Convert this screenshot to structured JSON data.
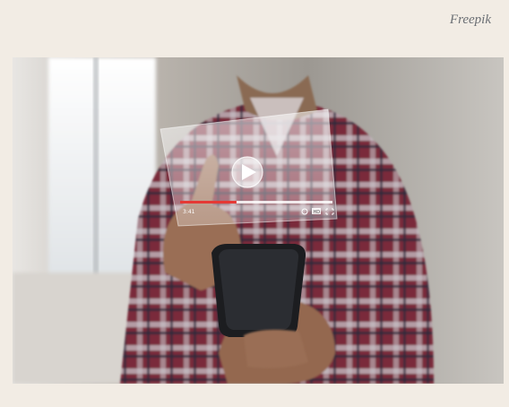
{
  "credit": {
    "text": "Freepik"
  },
  "player": {
    "time_label": "3:41",
    "quality_label": "HD"
  },
  "colors": {
    "page_background": "#f2ece4",
    "progress_played": "#e53935",
    "progress_track": "#ffffff"
  },
  "progress": {
    "played_fraction": 0.37
  }
}
